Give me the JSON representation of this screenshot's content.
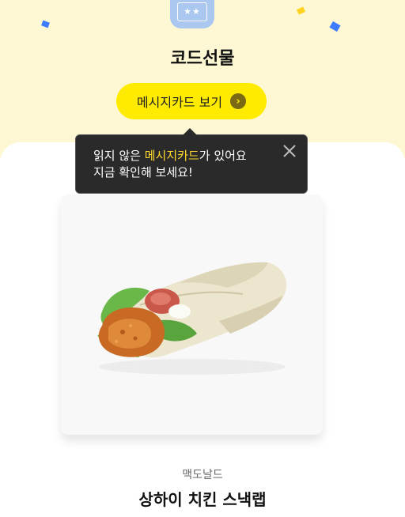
{
  "header": {
    "title": "코드선물",
    "card_icon": "gift-card-icon",
    "card_icon_text": "★★"
  },
  "message_button": {
    "label": "메시지카드 보기",
    "icon": "chevron-right-icon"
  },
  "tooltip": {
    "line1_before": "읽지 않은 ",
    "line1_highlight": "메시지카드",
    "line1_after": "가 있어요",
    "line2": "지금 확인해 보세요!",
    "close_icon": "close-icon"
  },
  "product": {
    "image": "chicken-snack-wrap-image",
    "brand": "맥도날드",
    "name": "상하이 치킨 스낵랩"
  },
  "colors": {
    "top_background": "#fdf7d3",
    "button_yellow": "#ffeb00",
    "tooltip_background": "#2a2a2a",
    "tooltip_highlight": "#ffd92e",
    "confetti_blue": "#3d7bff",
    "confetti_yellow": "#ffd21f",
    "card_icon_blue": "#a9c7ef"
  }
}
